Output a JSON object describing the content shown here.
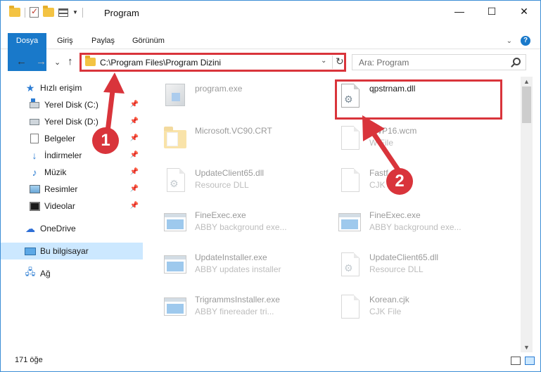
{
  "window": {
    "title": "Program",
    "minimize": "—",
    "maximize": "☐",
    "close": "✕"
  },
  "ribbon": {
    "tabs": [
      "Dosya",
      "Giriş",
      "Paylaş",
      "Görünüm"
    ],
    "help": "?"
  },
  "nav": {
    "back": "←",
    "forward": "→",
    "recent": "⌄",
    "up": "↑"
  },
  "address": {
    "path": "C:\\Program Files\\Program Dizini"
  },
  "search": {
    "placeholder": "Ara: Program"
  },
  "sidebar": {
    "items": [
      {
        "label": "Hızlı erişim",
        "icon": "star-icon"
      },
      {
        "label": "Yerel Disk (C:)",
        "icon": "disk-icon"
      },
      {
        "label": "Yerel Disk (D:)",
        "icon": "disk-icon"
      },
      {
        "label": "Belgeler",
        "icon": "documents-icon"
      },
      {
        "label": "İndirmeler",
        "icon": "downloads-icon"
      },
      {
        "label": "Müzik",
        "icon": "music-icon"
      },
      {
        "label": "Resimler",
        "icon": "pictures-icon"
      },
      {
        "label": "Videolar",
        "icon": "videos-icon"
      },
      {
        "label": "OneDrive",
        "icon": "onedrive-icon"
      },
      {
        "label": "Bu bilgisayar",
        "icon": "computer-icon"
      },
      {
        "label": "Ağ",
        "icon": "network-icon"
      }
    ]
  },
  "files": [
    {
      "name": "program.exe",
      "desc": "",
      "icon": "setup-icon"
    },
    {
      "name": "qpstrnam.dll",
      "desc": "",
      "icon": "dll-icon"
    },
    {
      "name": "Microsoft.VC90.CRT",
      "desc": "",
      "icon": "folder-icon"
    },
    {
      "name": "oWP16.wcm",
      "desc": "W File",
      "icon": "file-icon"
    },
    {
      "name": "UpdateClient65.dll",
      "desc": "Resource DLL",
      "icon": "dll-icon"
    },
    {
      "name": "Fastf   .cjk",
      "desc": "CJK File",
      "icon": "file-icon"
    },
    {
      "name": "FineExec.exe",
      "desc": "ABBY background exe...",
      "icon": "app-icon"
    },
    {
      "name": "FineExec.exe",
      "desc": "ABBY background exe...",
      "icon": "app-icon"
    },
    {
      "name": "UpdateInstaller.exe",
      "desc": "ABBY updates installer",
      "icon": "app-icon"
    },
    {
      "name": "UpdateClient65.dll",
      "desc": "Resource DLL",
      "icon": "dll-icon"
    },
    {
      "name": "TrigrammsInstaller.exe",
      "desc": "ABBY finereader tri...",
      "icon": "app-icon"
    },
    {
      "name": "Korean.cjk",
      "desc": "CJK File",
      "icon": "file-icon"
    }
  ],
  "status": {
    "count": "171 öğe"
  },
  "annotations": {
    "step1": "1",
    "step2": "2",
    "color": "#d9343b"
  }
}
